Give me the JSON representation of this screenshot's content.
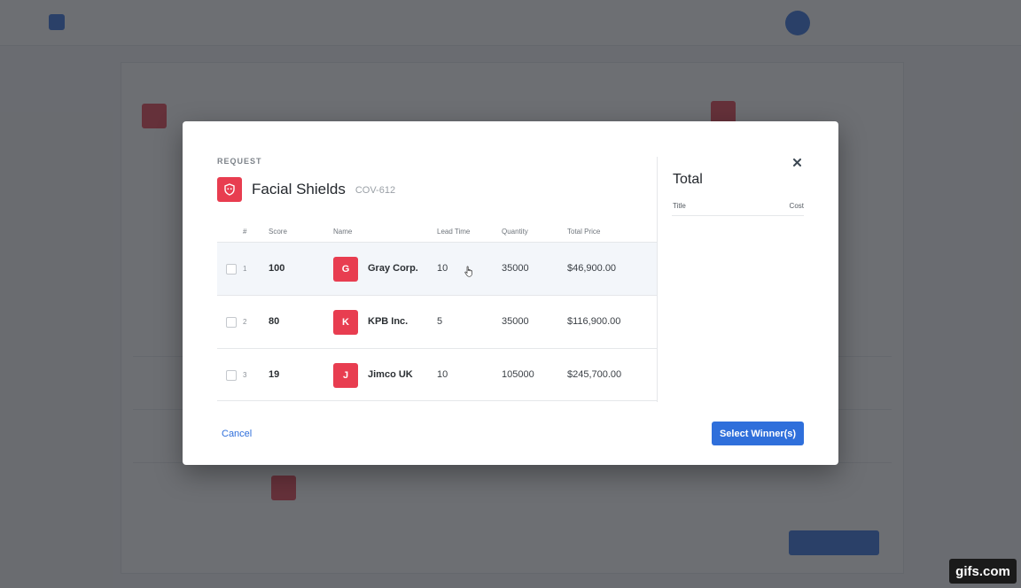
{
  "modal": {
    "section_label": "REQUEST",
    "request_title": "Facial Shields",
    "request_code": "COV-612",
    "table": {
      "headers": [
        "#",
        "Score",
        "Name",
        "Lead Time",
        "Quantity",
        "Total Price"
      ],
      "rows": [
        {
          "index": "1",
          "score": "100",
          "initial": "G",
          "name": "Gray Corp.",
          "lead_time": "10",
          "quantity": "35000",
          "total_price": "$46,900.00"
        },
        {
          "index": "2",
          "score": "80",
          "initial": "K",
          "name": "KPB Inc.",
          "lead_time": "5",
          "quantity": "35000",
          "total_price": "$116,900.00"
        },
        {
          "index": "3",
          "score": "19",
          "initial": "J",
          "name": "Jimco UK",
          "lead_time": "10",
          "quantity": "105000",
          "total_price": "$245,700.00"
        }
      ]
    },
    "total": {
      "title": "Total",
      "col_title": "Title",
      "col_cost": "Cost"
    },
    "cancel_label": "Cancel",
    "select_label": "Select Winner(s)"
  },
  "watermark": "gifs.com",
  "colors": {
    "accent": "#2f6fdb",
    "avatar": "#e83d50"
  },
  "icons": {
    "close": "close-icon",
    "request": "shield-icon",
    "pointer": "hand-pointer-icon"
  }
}
